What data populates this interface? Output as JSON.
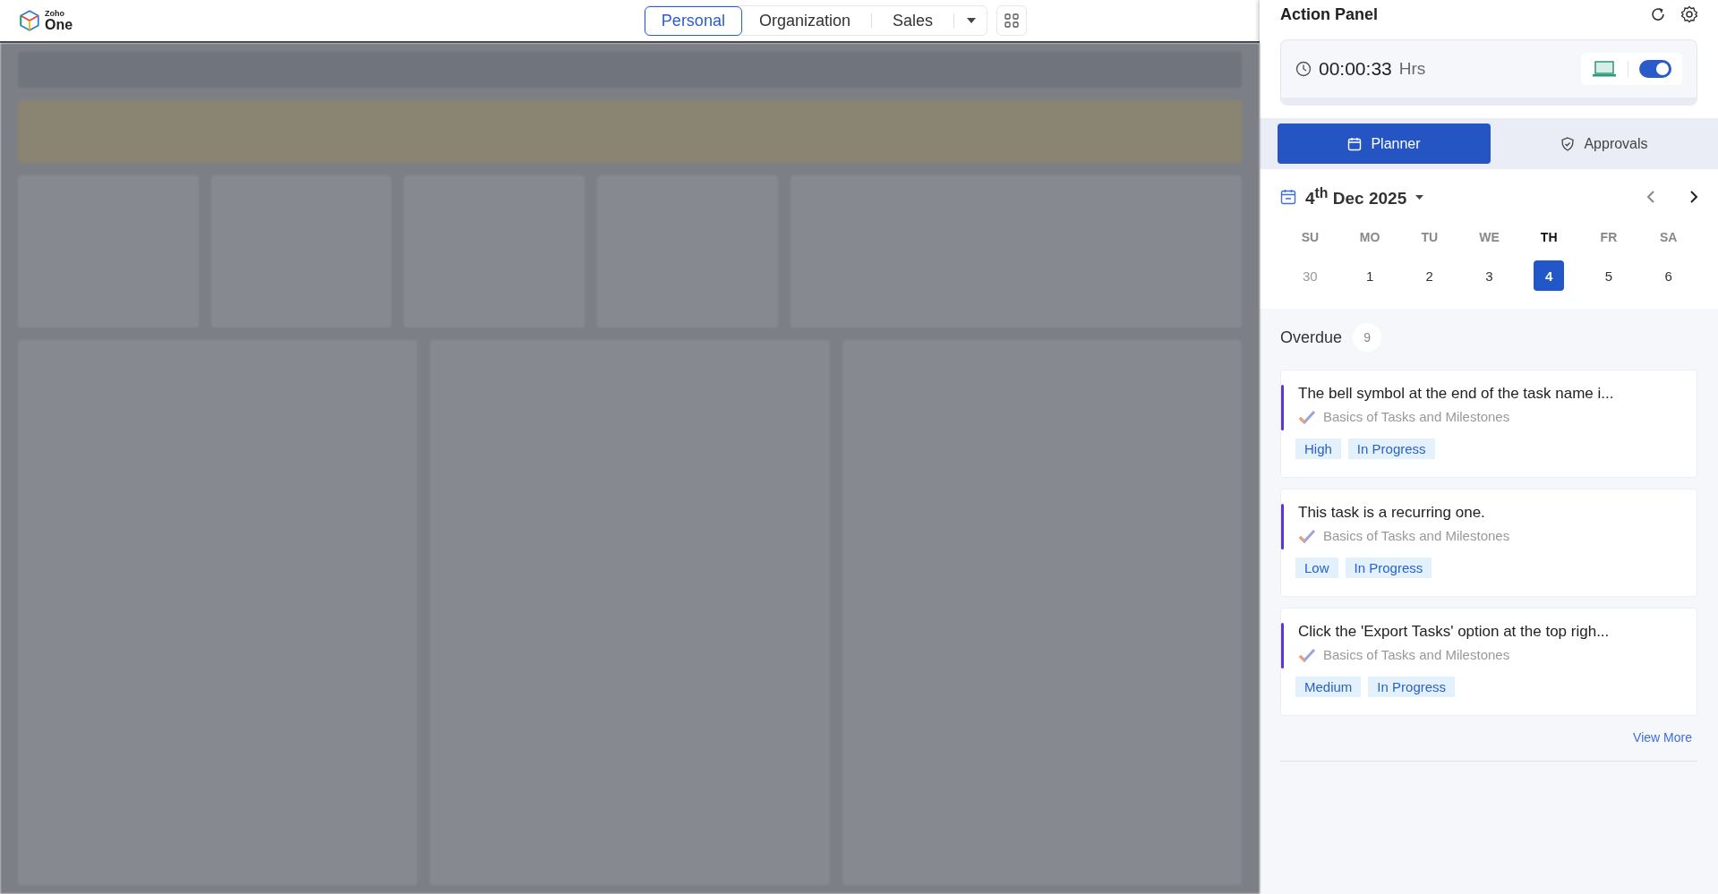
{
  "top_bar": {
    "logo": {
      "brand": "Zoho",
      "product": "One"
    },
    "tabs": [
      {
        "label": "Personal",
        "selected": true
      },
      {
        "label": "Organization",
        "selected": false
      },
      {
        "label": "Sales",
        "selected": false
      }
    ]
  },
  "action_panel": {
    "title": "Action Panel",
    "timer": {
      "time": "00:00:33",
      "unit": "Hrs",
      "toggle_on": true
    },
    "tabs": [
      {
        "label": "Planner",
        "selected": true,
        "kind": "calendar"
      },
      {
        "label": "Approvals",
        "selected": false,
        "kind": "shield"
      }
    ],
    "date": "4$^{th}$ Dec 2025",
    "weekdays": [
      {
        "label": "SU",
        "selected": false
      },
      {
        "label": "MO",
        "selected": false
      },
      {
        "label": "TU",
        "selected": false
      },
      {
        "label": "WE",
        "selected": false
      },
      {
        "label": "TH",
        "selected": true
      },
      {
        "label": "FR",
        "selected": false
      },
      {
        "label": "SA",
        "selected": false
      }
    ],
    "days": [
      {
        "label": "30",
        "selected": false,
        "other_month": true
      },
      {
        "label": "1",
        "selected": false,
        "other_month": false
      },
      {
        "label": "2",
        "selected": false,
        "other_month": false
      },
      {
        "label": "3",
        "selected": false,
        "other_month": false
      },
      {
        "label": "4",
        "selected": true,
        "other_month": false
      },
      {
        "label": "5",
        "selected": false,
        "other_month": false
      },
      {
        "label": "6",
        "selected": false,
        "other_month": false
      }
    ],
    "overdue": {
      "label": "Overdue",
      "count": "9"
    },
    "tasks": [
      {
        "title": "The bell symbol at the end of the task name i...",
        "project": "Basics of Tasks and Milestones",
        "priority": "High",
        "status": "In Progress"
      },
      {
        "title": "This task is a recurring one.",
        "project": "Basics of Tasks and Milestones",
        "priority": "Low",
        "status": "In Progress"
      },
      {
        "title": "Click the 'Export Tasks' option at the top righ...",
        "project": "Basics of Tasks and Milestones",
        "priority": "Medium",
        "status": "In Progress"
      }
    ],
    "view_more": "View More"
  }
}
